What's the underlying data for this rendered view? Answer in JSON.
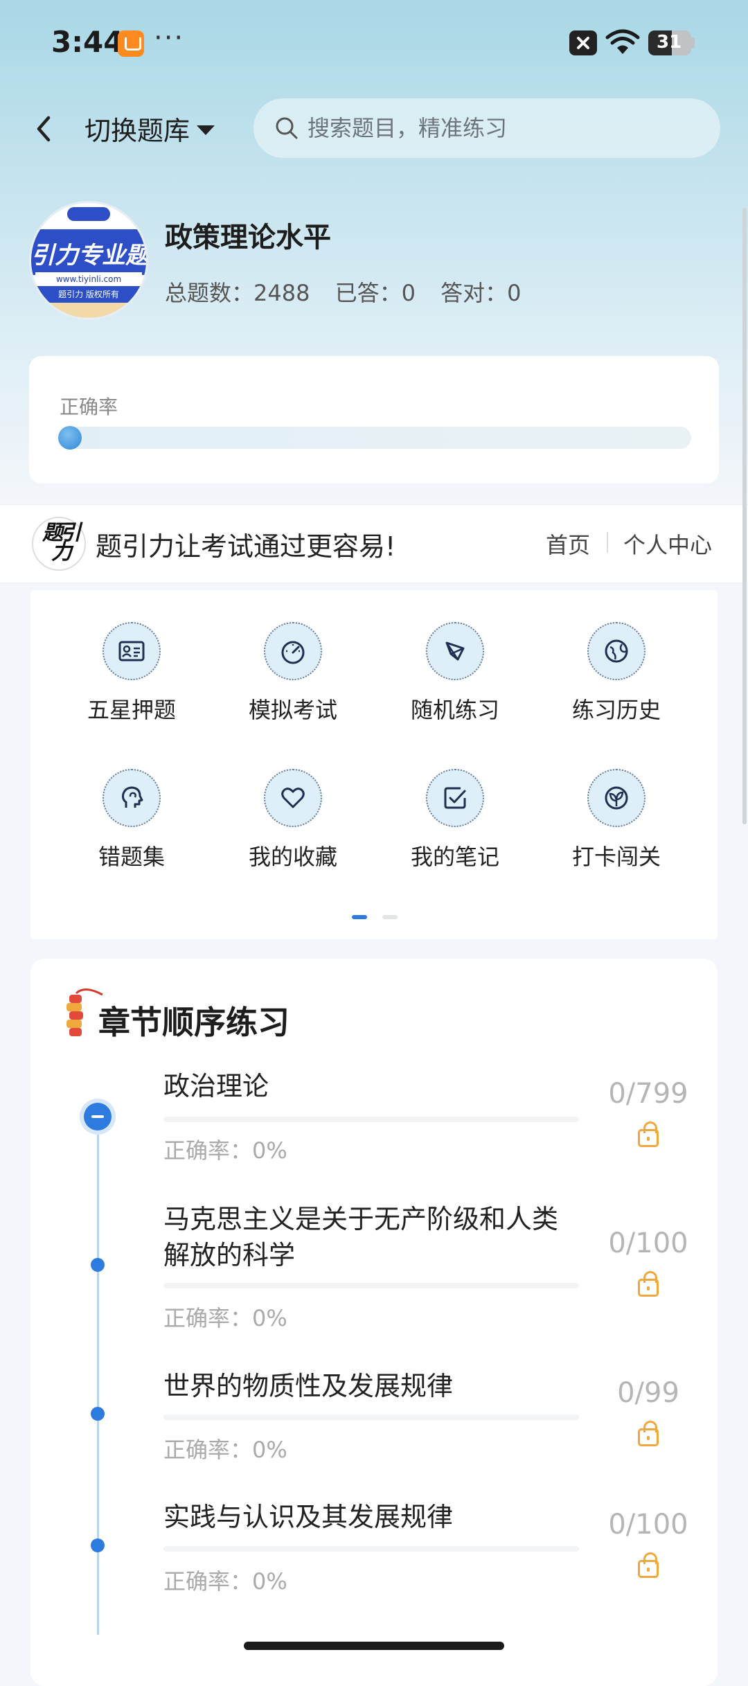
{
  "status_bar": {
    "time": "3:44",
    "dots": "···",
    "battery": "31"
  },
  "header": {
    "switch_label": "切换题库",
    "search_placeholder": "搜索题目，精准练习"
  },
  "library": {
    "avatar_text": "引力专业题",
    "avatar_url": "www.tiyinli.com",
    "avatar_footer": "题引力 版权所有",
    "title": "政策理论水平",
    "stats": {
      "total": "总题数：2488",
      "answered": "已答：0",
      "correct": "答对：0"
    }
  },
  "accuracy": {
    "label": "正确率",
    "value": 0
  },
  "banner": {
    "logo": "题引力",
    "slogan": "题引力让考试通过更容易!",
    "home": "首页",
    "profile": "个人中心"
  },
  "features": [
    {
      "label": "五星押题",
      "icon": "id-card-icon"
    },
    {
      "label": "模拟考试",
      "icon": "speedometer-icon"
    },
    {
      "label": "随机练习",
      "icon": "shuffle-icon"
    },
    {
      "label": "练习历史",
      "icon": "globe-icon"
    },
    {
      "label": "错题集",
      "icon": "head-icon"
    },
    {
      "label": "我的收藏",
      "icon": "heart-icon"
    },
    {
      "label": "我的笔记",
      "icon": "note-check-icon"
    },
    {
      "label": "打卡闯关",
      "icon": "sprout-icon"
    }
  ],
  "chapter_section": {
    "title": "章节顺序练习",
    "chapters": [
      {
        "name": "政治理论",
        "accuracy": "正确率：0%",
        "count": "0/799"
      },
      {
        "name": "马克思主义是关于无产阶级和人类解放的科学",
        "accuracy": "正确率：0%",
        "count": "0/100"
      },
      {
        "name": "世界的物质性及发展规律",
        "accuracy": "正确率：0%",
        "count": "0/99"
      },
      {
        "name": "实践与认识及其发展规律",
        "accuracy": "正确率：0%",
        "count": "0/100"
      }
    ]
  },
  "colors": {
    "accent": "#2e7be0",
    "lock": "#f0a83c"
  }
}
